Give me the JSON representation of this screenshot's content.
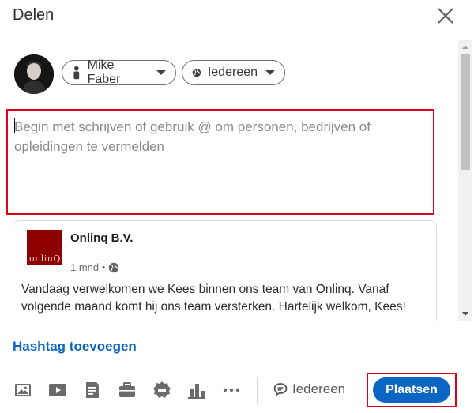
{
  "dialog": {
    "title": "Delen"
  },
  "author": {
    "name": "Mike Faber"
  },
  "audience": {
    "label": "Iedereen"
  },
  "editor": {
    "placeholder": "Begin met schrijven of gebruik @ om personen, bedrijven of opleidingen te vermelden"
  },
  "shared_post": {
    "company": "Onlinq B.V.",
    "logo_text": "onlinQ",
    "meta": "1 mnd •",
    "text": "Vandaag verwelkomen we Kees binnen ons team van Onlinq. Vanaf volgende maand komt hij ons team versterken. Hartelijk welkom, Kees!"
  },
  "footer": {
    "hashtag_label": "Hashtag toevoegen",
    "comment_audience": "Iedereen",
    "post_button": "Plaatsen",
    "tools": [
      "photo-icon",
      "video-icon",
      "document-icon",
      "job-icon",
      "badge-icon",
      "poll-icon",
      "more-icon"
    ]
  },
  "colors": {
    "accent": "#0a66c2",
    "highlight_border": "#e0001b",
    "logo_bg": "#8f0000"
  }
}
